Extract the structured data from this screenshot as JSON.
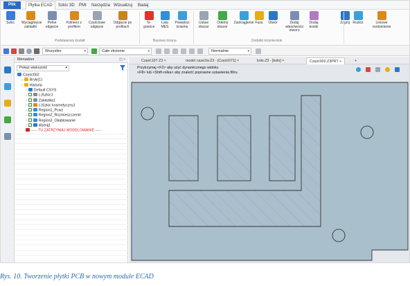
{
  "menu": {
    "tabs": [
      "Plik",
      "Płytka ECAD",
      "Szkic 3D",
      "PMI",
      "Narzędzia",
      "Wizualizuj",
      "Badaj"
    ],
    "active": "Płytka ECAD"
  },
  "ribbon": {
    "buttons": [
      {
        "label": "Szkic",
        "icon": "sketch-icon",
        "color": "#3a7bd5"
      },
      {
        "label": "Wyciągnięcie zakładki",
        "icon": "extrude-tab-icon",
        "color": "#d98a1e"
      },
      {
        "label": "Pełne odgięcie",
        "icon": "full-bend-icon",
        "color": "#7a8fb0"
      },
      {
        "label": "Kołnierz z profilem",
        "icon": "flange-profile-icon",
        "color": "#d98a1e"
      },
      {
        "label": "Częściowe odgięcie",
        "icon": "partial-bend-icon",
        "color": "#9aa4b3"
      },
      {
        "label": "Odgięcie po profilach",
        "icon": "bend-profiles-icon",
        "color": "#c8841e"
      },
      {
        "label": "N-granice",
        "icon": "n-boundary-icon",
        "color": "#e0322b"
      },
      {
        "label": "Łata MES",
        "icon": "mes-patch-icon",
        "color": "#2f8fd8"
      },
      {
        "label": "Powiększ ściankę",
        "icon": "enlarge-wall-icon",
        "color": "#3aa0d9"
      },
      {
        "label": "Ustaw obszar",
        "icon": "set-area-icon",
        "color": "#9aa4b3"
      },
      {
        "label": "Odetnij obszar",
        "icon": "cut-area-icon",
        "color": "#44a844"
      },
      {
        "label": "Zaokrąglenie",
        "icon": "fillet-icon",
        "color": "#3aa0d9"
      },
      {
        "label": "Faza",
        "icon": "chamfer-icon",
        "color": "#e2b013"
      },
      {
        "label": "Otwór",
        "icon": "hole-icon",
        "color": "#2b79c4"
      },
      {
        "label": "Dodaj właściwości otworu",
        "icon": "hole-props-icon",
        "color": "#7a8fb0"
      },
      {
        "label": "Dodaj kostki",
        "icon": "add-dice-icon",
        "color": "#b07ac4"
      },
      {
        "label": "Zagnij",
        "icon": "fold-icon",
        "color": "#2b79c4"
      },
      {
        "label": "Rozłóż",
        "icon": "unfold-icon",
        "color": "#3aa0d9"
      },
      {
        "label": "Liniowe rozdzielenie",
        "icon": "linear-split-icon",
        "color": "#d98a1e"
      }
    ],
    "groups": [
      "Podstawowy kształt",
      "Bazowa ściana",
      "Dodatki inżynierskie"
    ]
  },
  "toolbar": {
    "filter_value": "Wszystko",
    "assembly_value": "Całe złożenie",
    "display_value": "Normalnie"
  },
  "tree": {
    "header": "Menadżer",
    "search_placeholder": "Pokaż większość",
    "items": [
      {
        "label": "Część002",
        "indent": 0,
        "icon": "#3a7bd5",
        "check": false
      },
      {
        "label": "Bryły(1)",
        "indent": 1,
        "icon": "#e2b013",
        "check": false
      },
      {
        "label": "Historia",
        "indent": 1,
        "icon": "#e2b013",
        "check": false
      },
      {
        "label": "Default CSYS",
        "indent": 2,
        "icon": "#2b79c4",
        "check": false
      },
      {
        "label": "(-)Szkic1",
        "indent": 2,
        "icon": "#8a8a8a",
        "check": true
      },
      {
        "label": "Zakładka1",
        "indent": 2,
        "icon": "#7a8fb0",
        "check": true
      },
      {
        "label": "(-)Szkic kosmetyczny1",
        "indent": 2,
        "icon": "#d98a1e",
        "check": true
      },
      {
        "label": "Region1_Pcwz",
        "indent": 2,
        "icon": "#2f8fd8",
        "check": true
      },
      {
        "label": "Region2_Rozmieszczenie",
        "indent": 2,
        "icon": "#2f8fd8",
        "check": true
      },
      {
        "label": "Region3_Okablowanie",
        "indent": 2,
        "icon": "#2f8fd8",
        "check": true
      },
      {
        "label": "Wytnij1",
        "indent": 2,
        "icon": "#2b79c4",
        "check": true
      },
      {
        "label": "----- TU ZATRZYMAJ MODELOWANIE -----",
        "indent": 2,
        "icon": "#d42020",
        "check": false,
        "stop": true
      }
    ]
  },
  "doc_tabs": [
    {
      "label": "Część107.Z3",
      "active": false
    },
    {
      "label": "model case2w.Z3 - [Część071]",
      "active": false
    },
    {
      "label": "koło.Z3 - [koło]",
      "active": false
    },
    {
      "label": "Część002.Z3PRT",
      "active": true
    }
  ],
  "viewport": {
    "message_line1": "Przytrzymaj <F2> aby użyć dynamicznego widoku",
    "message_line2": "<F8> lub <Shift-rolka> aby znaleźć poprawne ustawienia filtru."
  },
  "caption": "Rys. 10. Tworzenie płytki PCB w nowym module ECAD"
}
